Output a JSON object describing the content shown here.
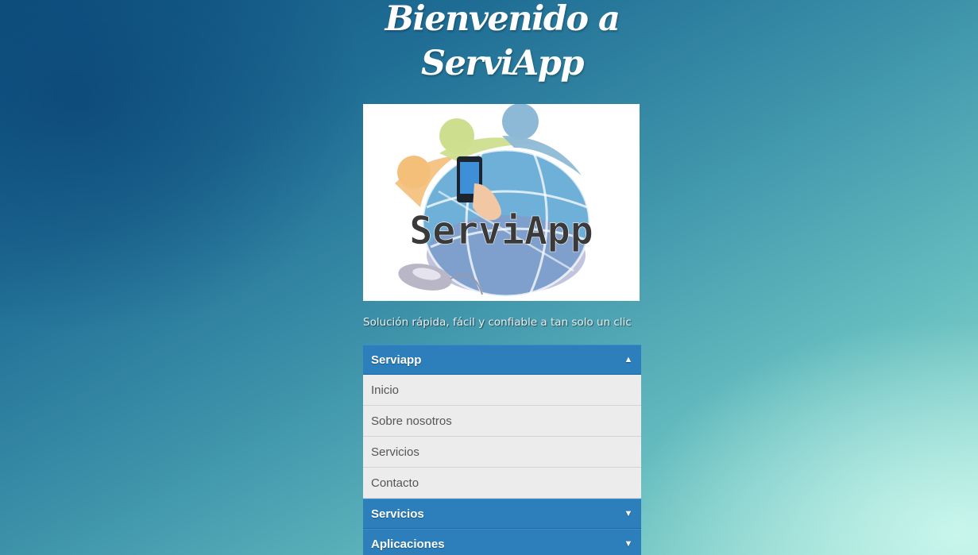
{
  "header": {
    "title_line1": "Bienvenido a",
    "title_line2": "ServiApp"
  },
  "logo": {
    "text": "ServiApp",
    "alt": "ServiApp logo",
    "colors": {
      "orange": "#f3bf79",
      "green": "#cddf8f",
      "blue": "#8eb9d6",
      "globe": "#6fb0d8",
      "text": "#3a3a3a"
    }
  },
  "tagline": "Solución rápida, fácil y confiable a tan solo un clic",
  "menu": {
    "sections": [
      {
        "label": "Serviapp",
        "arrow": "▲",
        "items": [
          "Inicio",
          "Sobre nosotros",
          "Servicios",
          "Contacto"
        ]
      },
      {
        "label": "Servicios",
        "arrow": "▼"
      },
      {
        "label": "Aplicaciones",
        "arrow": "▼"
      }
    ]
  },
  "colors": {
    "header_blue": "#2c7fbb",
    "item_bg": "#ececec",
    "item_text": "#555555"
  }
}
